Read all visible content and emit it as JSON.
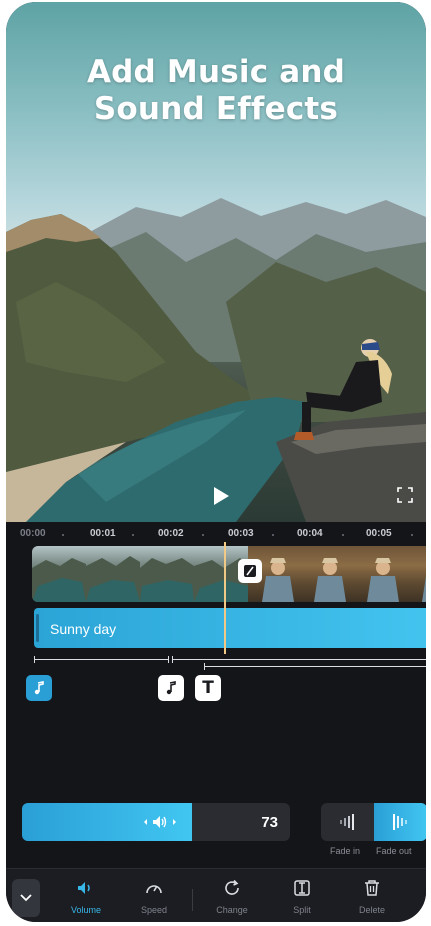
{
  "promo": {
    "title_line1": "Add Music and",
    "title_line2": "Sound Effects"
  },
  "ruler": {
    "labels": [
      "00:00",
      "00:01",
      "00:02",
      "00:03",
      "00:04",
      "00:05"
    ]
  },
  "audio_track": {
    "label": "Sunny day",
    "color": "#2ba4d6"
  },
  "volume": {
    "value": "73",
    "level_percent": 73,
    "accent_color": "#38b6e8"
  },
  "fade": {
    "in_label": "Fade in",
    "out_label": "Fade out",
    "selected": "Fade out"
  },
  "toolbar": {
    "items": [
      {
        "label": "Volume",
        "icon": "speaker-icon",
        "active": true
      },
      {
        "label": "Speed",
        "icon": "speedometer-icon",
        "active": false
      },
      {
        "label": "Change",
        "icon": "refresh-icon",
        "active": false
      },
      {
        "label": "Split",
        "icon": "split-icon",
        "active": false
      },
      {
        "label": "Delete",
        "icon": "trash-icon",
        "active": false
      }
    ]
  },
  "markers": {
    "text_marker": "T"
  }
}
